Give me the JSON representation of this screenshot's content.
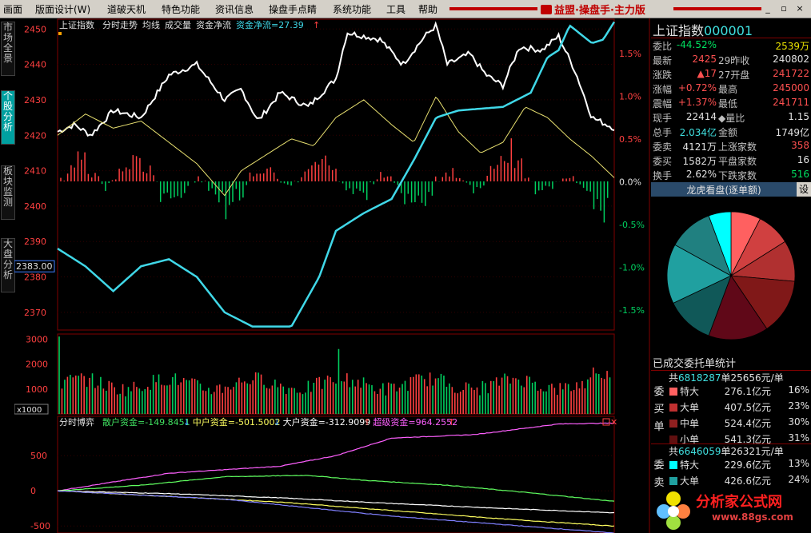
{
  "menu": [
    "画面",
    "版面设计(W)",
    "道破天机",
    "特色功能",
    "资讯信息",
    "操盘手点睛",
    "系统功能",
    "工具",
    "帮助"
  ],
  "brand": "益盟·操盘手·主力版",
  "window_buttons": [
    "_",
    "▫",
    "×"
  ],
  "left_tabs": [
    "市场全景",
    "个股分析",
    "板块监测",
    "大盘分析"
  ],
  "chart": {
    "header_left": "上证指数",
    "header_items": [
      "分时走势",
      "均线",
      "成交量",
      "资金净流"
    ],
    "flow_label": "资金净流=27.39",
    "flow_arrow": "↑",
    "price_ticks": [
      "2450",
      "2440",
      "2430",
      "2420",
      "2410",
      "2400",
      "2390",
      "2380",
      "2370"
    ],
    "pct_ticks": [
      "1.5%",
      "1.0%",
      "0.5%",
      "0.0%",
      "-0.5%",
      "-1.0%",
      "-1.5%"
    ],
    "current_price": "2383.00",
    "vol_ticks": [
      "3000",
      "2000",
      "1000"
    ],
    "vol_unit": "x1000",
    "bottom_header": "分时博弈",
    "bottom_items": [
      {
        "label": "散户资金=-149.8451",
        "arrow": "↓",
        "color": "#ffffff"
      },
      {
        "label": "中户资金=-501.5002",
        "arrow": "↓",
        "color": "#ffff60"
      },
      {
        "label": "大户资金=-312.9099",
        "arrow": "↑",
        "color": "#ffffff"
      },
      {
        "label": "超级资金=964.2552",
        "arrow": "↑",
        "color": "#ff60ff"
      }
    ],
    "bottom_ticks": [
      "500",
      "0",
      "-500"
    ],
    "colors": {
      "price": "#ffffff",
      "avg": "#e8e070",
      "flow": "#40d8e8",
      "up": "#ff4040",
      "down": "#00d060",
      "grid": "#800000"
    }
  },
  "right": {
    "title": "上证指数",
    "code": "000001",
    "rows": [
      {
        "l1": "委比",
        "v1": "-44.52%",
        "c1": "green",
        "l2": "",
        "v2": "2539万",
        "c2": "yellow"
      },
      {
        "l1": "最新",
        "v1": "2425",
        "c1": "red",
        "l2": "29昨收",
        "v2": "2408",
        "c2": "white",
        "v2b": "02"
      },
      {
        "l1": "涨跌",
        "v1": "▲17",
        "c1": "red",
        "l2": "27开盘",
        "v2": "2417",
        "c2": "red",
        "v2b": "22"
      },
      {
        "l1": "涨幅",
        "v1": "+0.72%",
        "c1": "red",
        "l2": "最高",
        "v2": "2450",
        "c2": "red",
        "v2b": "00"
      },
      {
        "l1": "震幅",
        "v1": "+1.37%",
        "c1": "red",
        "l2": "最低",
        "v2": "2417",
        "c2": "red",
        "v2b": "11"
      },
      {
        "l1": "现手",
        "v1": "22414",
        "c1": "white",
        "l2": "◆量比",
        "v2": "1.15",
        "c2": "white"
      },
      {
        "l1": "总手",
        "v1": "2.034亿",
        "c1": "cyan",
        "l2": "金额",
        "v2": "1749亿",
        "c2": "white"
      },
      {
        "l1": "委卖",
        "v1": "4121万",
        "c1": "white",
        "l2": "上涨家数",
        "v2": "358",
        "c2": "red"
      },
      {
        "l1": "委买",
        "v1": "1582万",
        "c1": "white",
        "l2": "平盘家数",
        "v2": "16",
        "c2": "white"
      },
      {
        "l1": "换手",
        "v1": "2.62%",
        "c1": "white",
        "l2": "下跌家数",
        "v2": "516",
        "c2": "green"
      }
    ],
    "lhb_title": "龙虎看盘(逐单额)",
    "lhb_btn": "设",
    "pie_slices": [
      {
        "value": 8,
        "color": "#ff6060"
      },
      {
        "value": 9,
        "color": "#d04040"
      },
      {
        "value": 11,
        "color": "#b03030"
      },
      {
        "value": 15,
        "color": "#801818"
      },
      {
        "value": 16,
        "color": "#600818"
      },
      {
        "value": 13,
        "color": "#105858"
      },
      {
        "value": 16,
        "color": "#20a0a0"
      },
      {
        "value": 12,
        "color": "#208080"
      },
      {
        "value": 6,
        "color": "#00ffff"
      }
    ],
    "stats_title": "已成交委托单统计",
    "buy": {
      "label": [
        "委",
        "买",
        "单"
      ],
      "summary": "共6818287单25656元/单",
      "summary_parts": [
        "共",
        "6818287",
        "单",
        "25656元/单"
      ],
      "items": [
        {
          "name": "特大",
          "amt": "276.1亿元",
          "pct": "16%",
          "color": "#ff6060"
        },
        {
          "name": "大单",
          "amt": "407.5亿元",
          "pct": "23%",
          "color": "#c03030"
        },
        {
          "name": "中单",
          "amt": "524.4亿元",
          "pct": "30%",
          "color": "#902020"
        },
        {
          "name": "小单",
          "amt": "541.3亿元",
          "pct": "31%",
          "color": "#601010"
        }
      ]
    },
    "sell": {
      "label": [
        "委",
        "卖"
      ],
      "summary_parts": [
        "共",
        "6646059",
        "单",
        "26321元/单"
      ],
      "items": [
        {
          "name": "特大",
          "amt": "229.6亿元",
          "pct": "13%",
          "color": "#00ffff"
        },
        {
          "name": "大单",
          "amt": "426.6亿元",
          "pct": "24%",
          "color": "#20a0a0"
        }
      ]
    },
    "watermark": "分析家公式网",
    "watermark_url": "www.88gs.com"
  }
}
